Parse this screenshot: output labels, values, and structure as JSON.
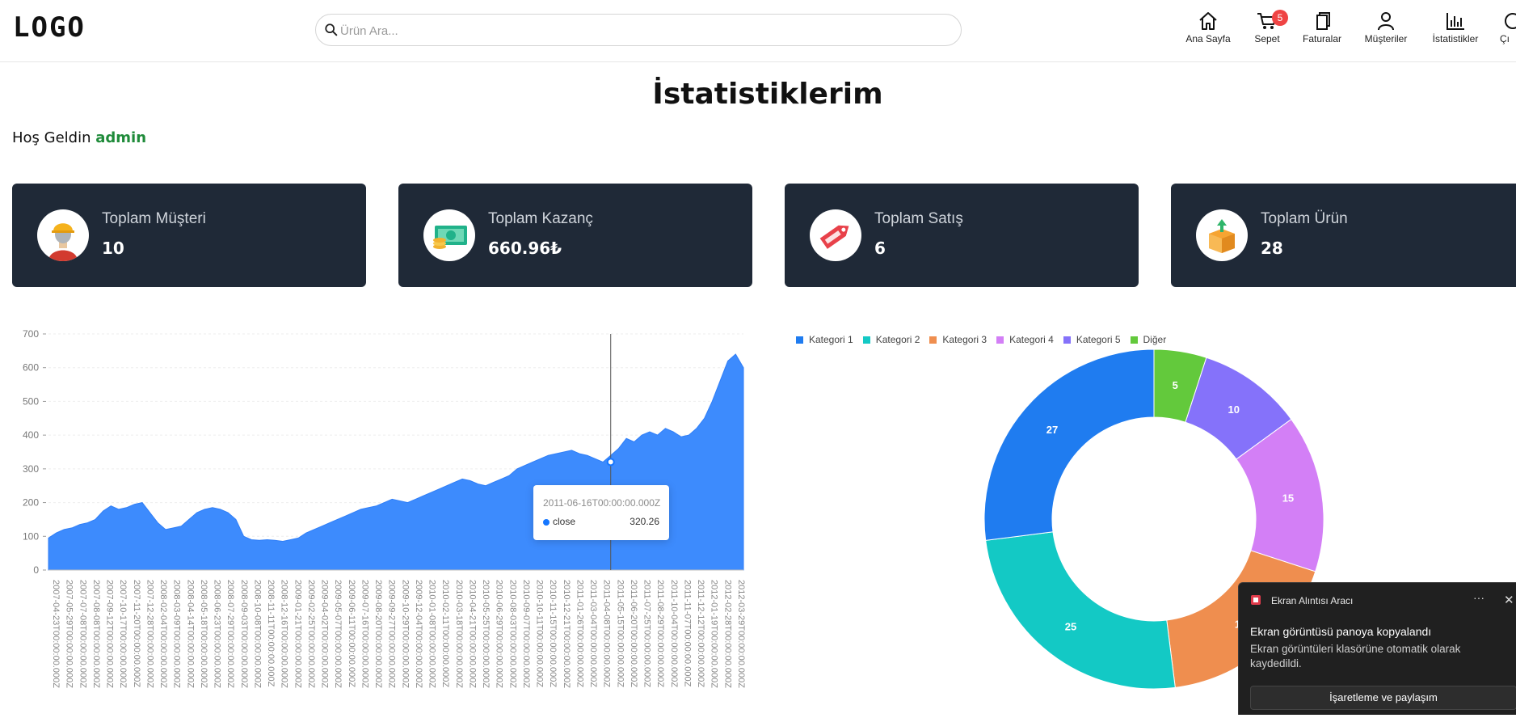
{
  "header": {
    "logo": "LOGO",
    "search_placeholder": "Ürün Ara...",
    "nav": [
      {
        "label": "Ana Sayfa",
        "icon": "home-icon"
      },
      {
        "label": "Sepet",
        "icon": "cart-icon",
        "badge": "5"
      },
      {
        "label": "Faturalar",
        "icon": "copy-icon"
      },
      {
        "label": "Müşteriler",
        "icon": "user-icon"
      },
      {
        "label": "İstatistikler",
        "icon": "bar-chart-icon"
      },
      {
        "label": "Çı",
        "icon": "logout-icon"
      }
    ]
  },
  "page": {
    "title": "İstatistiklerim",
    "welcome_prefix": "Hoş Geldin",
    "username": "admin"
  },
  "cards": [
    {
      "label": "Toplam Müşteri",
      "value": "10",
      "icon": "customer-icon"
    },
    {
      "label": "Toplam Kazanç",
      "value": "660.96₺",
      "icon": "money-icon"
    },
    {
      "label": "Toplam Satış",
      "value": "6",
      "icon": "sale-tag-icon"
    },
    {
      "label": "Toplam Ürün",
      "value": "28",
      "icon": "product-box-icon"
    }
  ],
  "chart_data": [
    {
      "type": "area",
      "series": [
        {
          "name": "close",
          "color": "#3d8bfd"
        }
      ],
      "ylim": [
        0,
        700
      ],
      "yticks": [
        0,
        100,
        200,
        300,
        400,
        500,
        600,
        700
      ],
      "x_tick_labels": [
        "2007-04-23T00:00:00.000Z",
        "2007-05-29T00:00:00.000Z",
        "2007-07-08T00:00:00.000Z",
        "2007-08-08T00:00:00.000Z",
        "2007-09-12T00:00:00.000Z",
        "2007-10-17T00:00:00.000Z",
        "2007-11-20T00:00:00.000Z",
        "2007-12-28T00:00:00.000Z",
        "2008-02-04T00:00:00.000Z",
        "2008-03-09T00:00:00.000Z",
        "2008-04-14T00:00:00.000Z",
        "2008-05-18T00:00:00.000Z",
        "2008-06-23T00:00:00.000Z",
        "2008-07-29T00:00:00.000Z",
        "2008-09-03T00:00:00.000Z",
        "2008-10-08T00:00:00.000Z",
        "2008-11-11T00:00:00.000Z",
        "2008-12-16T00:00:00.000Z",
        "2009-01-21T00:00:00.000Z",
        "2009-02-25T00:00:00.000Z",
        "2009-04-02T00:00:00.000Z",
        "2009-05-07T00:00:00.000Z",
        "2009-06-11T00:00:00.000Z",
        "2009-07-16T00:00:00.000Z",
        "2009-08-20T00:00:00.000Z",
        "2009-09-27T00:00:00.000Z",
        "2009-10-29T00:00:00.000Z",
        "2009-12-04T00:00:00.000Z",
        "2010-01-08T00:00:00.000Z",
        "2010-02-11T00:00:00.000Z",
        "2010-03-18T00:00:00.000Z",
        "2010-04-21T00:00:00.000Z",
        "2010-05-25T00:00:00.000Z",
        "2010-06-29T00:00:00.000Z",
        "2010-08-03T00:00:00.000Z",
        "2010-09-07T00:00:00.000Z",
        "2010-10-11T00:00:00.000Z",
        "2010-11-15T00:00:00.000Z",
        "2010-12-21T00:00:00.000Z",
        "2011-01-26T00:00:00.000Z",
        "2011-03-04T00:00:00.000Z",
        "2011-04-08T00:00:00.000Z",
        "2011-05-15T00:00:00.000Z",
        "2011-06-20T00:00:00.000Z",
        "2011-07-25T00:00:00.000Z",
        "2011-08-29T00:00:00.000Z",
        "2011-10-04T00:00:00.000Z",
        "2011-11-07T00:00:00.000Z",
        "2011-12-12T00:00:00.000Z",
        "2012-01-19T00:00:00.000Z",
        "2012-02-28T00:00:00.000Z",
        "2012-03-29T00:00:00.000Z"
      ],
      "values": [
        95,
        110,
        120,
        125,
        135,
        140,
        150,
        175,
        190,
        180,
        185,
        195,
        200,
        170,
        140,
        120,
        125,
        130,
        150,
        170,
        180,
        185,
        180,
        170,
        150,
        100,
        90,
        88,
        90,
        88,
        85,
        90,
        95,
        110,
        120,
        130,
        140,
        150,
        160,
        170,
        180,
        185,
        190,
        200,
        210,
        205,
        200,
        210,
        220,
        230,
        240,
        250,
        260,
        270,
        265,
        255,
        250,
        260,
        270,
        280,
        300,
        310,
        320,
        330,
        340,
        345,
        350,
        355,
        345,
        340,
        330,
        320,
        340,
        360,
        390,
        380,
        400,
        410,
        400,
        420,
        410,
        395,
        400,
        420,
        450,
        500,
        560,
        620,
        640,
        600
      ],
      "tooltip": {
        "title": "2011-06-16T00:00:00.000Z",
        "series": "close",
        "value": "320.26",
        "x_index": 72
      }
    },
    {
      "type": "pie",
      "donut": true,
      "legend_position": "top",
      "categories": [
        "Kategori 1",
        "Kategori 2",
        "Kategori 3",
        "Kategori 4",
        "Kategori 5",
        "Diğer"
      ],
      "values": [
        27,
        25,
        18,
        15,
        10,
        5
      ],
      "colors": [
        "#1f7cf0",
        "#13c9c5",
        "#ef8e4f",
        "#d37ff6",
        "#8572fa",
        "#63c93c"
      ],
      "slice_order": [
        "Diğer",
        "Kategori 5",
        "Kategori 4",
        "Kategori 3",
        "Kategori 2",
        "Kategori 1"
      ]
    }
  ],
  "toast": {
    "app_name": "Ekran Alıntısı Aracı",
    "heading": "Ekran görüntüsü panoya kopyalandı",
    "body": "Ekran görüntüleri klasörüne otomatik olarak kaydedildi.",
    "action": "İşaretleme ve paylaşım",
    "more": "···",
    "close": "✕"
  }
}
